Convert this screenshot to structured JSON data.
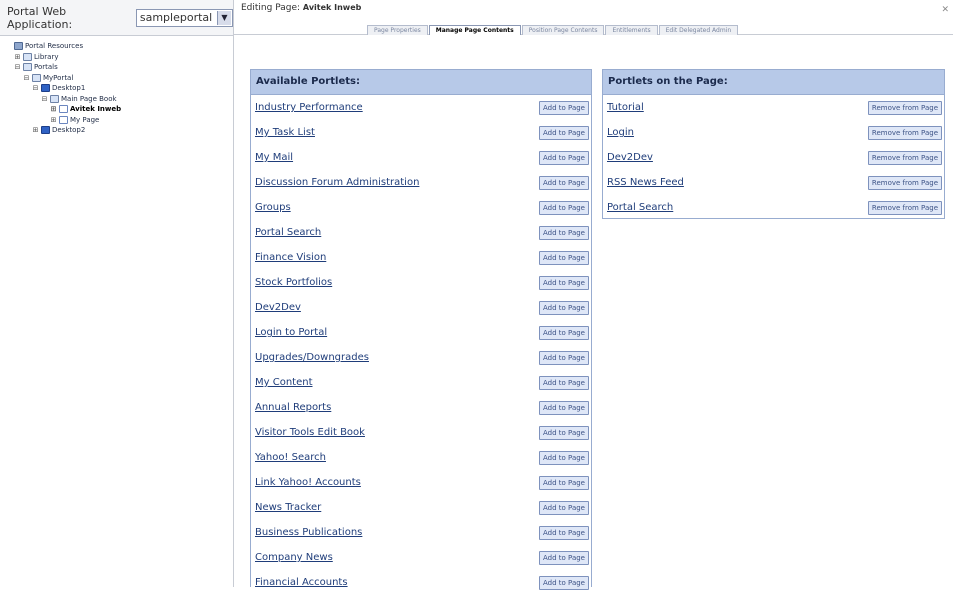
{
  "left_header": {
    "label": "Portal Web Application:",
    "app_select": "sampleportal"
  },
  "tree": [
    {
      "label": "Portal Resources",
      "indent": 0,
      "exp": "",
      "icon": "res"
    },
    {
      "label": "Library",
      "indent": 1,
      "exp": "⊞",
      "icon": "book"
    },
    {
      "label": "Portals",
      "indent": 1,
      "exp": "⊟",
      "icon": "book"
    },
    {
      "label": "MyPortal",
      "indent": 2,
      "exp": "⊟",
      "icon": "book"
    },
    {
      "label": "Desktop1",
      "indent": 3,
      "exp": "⊟",
      "icon": "desk"
    },
    {
      "label": "Main Page Book",
      "indent": 4,
      "exp": "⊟",
      "icon": "book"
    },
    {
      "label": "Avitek Inweb",
      "indent": 5,
      "exp": "⊞",
      "icon": "page",
      "selected": true
    },
    {
      "label": "My Page",
      "indent": 5,
      "exp": "⊞",
      "icon": "page"
    },
    {
      "label": "Desktop2",
      "indent": 3,
      "exp": "⊞",
      "icon": "desk"
    }
  ],
  "editing": {
    "prefix": "Editing Page:",
    "page_name": "Avitek Inweb",
    "tabs": [
      {
        "label": "Page Properties",
        "active": false
      },
      {
        "label": "Manage Page Contents",
        "active": true
      },
      {
        "label": "Position Page Contents",
        "active": false
      },
      {
        "label": "Entitlements",
        "active": false
      },
      {
        "label": "Edit Delegated Admin",
        "active": false
      }
    ],
    "close": "✕"
  },
  "available": {
    "title": "Available Portlets:",
    "button_label": "Add to Page",
    "items": [
      "Industry Performance",
      "My Task List",
      "My Mail",
      "Discussion Forum Administration",
      "Groups",
      "Portal Search",
      "Finance Vision",
      "Stock Portfolios",
      "Dev2Dev",
      "Login to Portal",
      "Upgrades/Downgrades",
      "My Content",
      "Annual Reports",
      "Visitor Tools Edit Book",
      "Yahoo! Search",
      "Link Yahoo! Accounts",
      "News Tracker",
      "Business Publications",
      "Company News",
      "Financial Accounts"
    ]
  },
  "on_page": {
    "title": "Portlets on the Page:",
    "button_label": "Remove from Page",
    "items": [
      "Tutorial",
      "Login",
      "Dev2Dev",
      "RSS News Feed",
      "Portal Search"
    ]
  }
}
